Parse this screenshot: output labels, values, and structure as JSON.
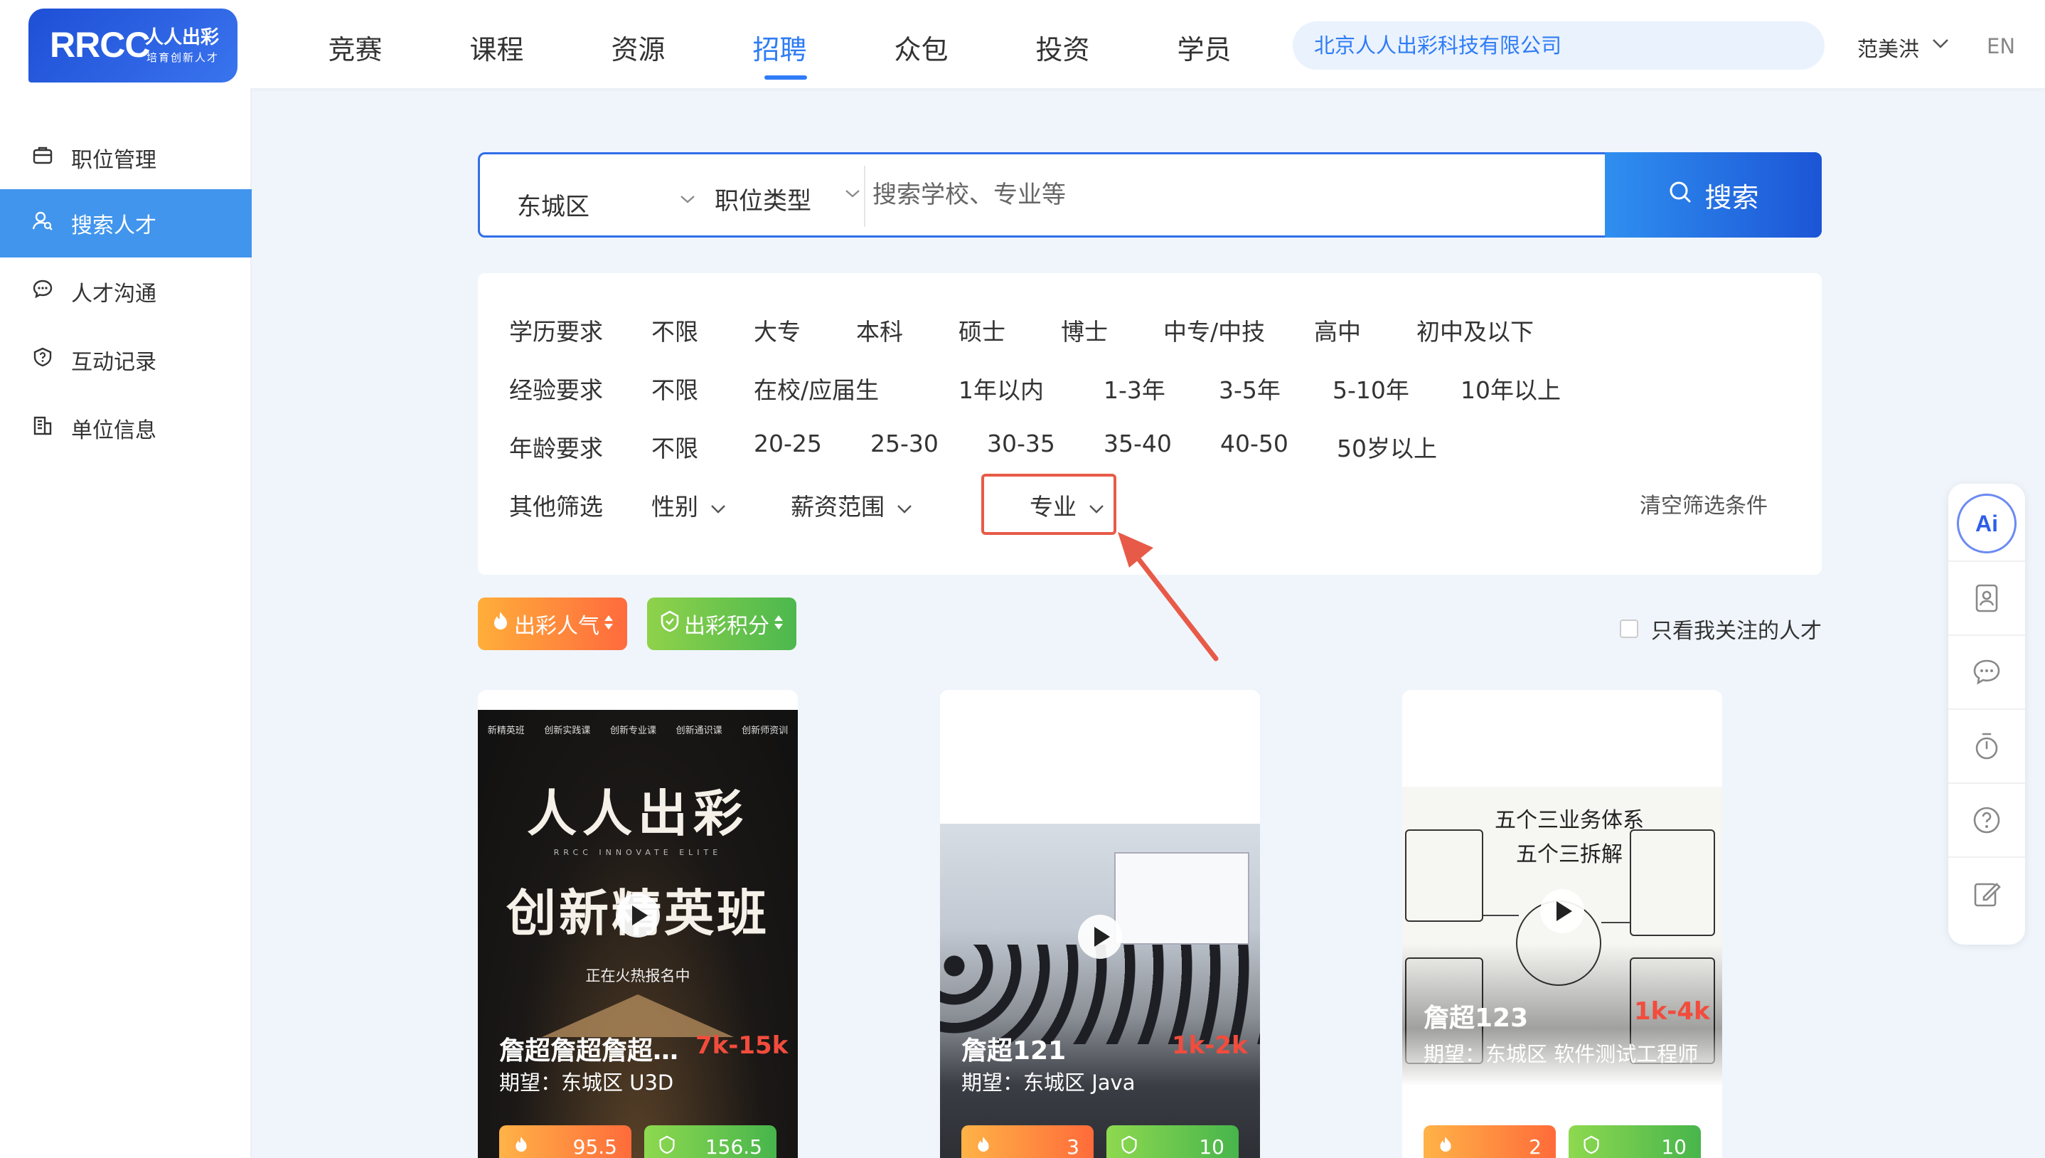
{
  "header": {
    "logo_main": "RRCC",
    "logo_cn": "人人出彩",
    "logo_sub": "培育创新人才",
    "nav": [
      "竞赛",
      "课程",
      "资源",
      "招聘",
      "众包",
      "投资",
      "学员"
    ],
    "active_nav": "招聘",
    "company": "北京人人出彩科技有限公司",
    "user": "范美洪",
    "lang": "EN"
  },
  "sidebar": {
    "items": [
      {
        "label": "职位管理",
        "icon": "briefcase-icon"
      },
      {
        "label": "搜索人才",
        "icon": "user-search-icon"
      },
      {
        "label": "人才沟通",
        "icon": "chat-icon"
      },
      {
        "label": "互动记录",
        "icon": "question-shield-icon"
      },
      {
        "label": "单位信息",
        "icon": "building-icon"
      }
    ],
    "active": "搜索人才"
  },
  "search": {
    "area": "东城区",
    "job_type": "职位类型",
    "placeholder": "搜索学校、专业等",
    "button": "搜索"
  },
  "filters": {
    "education": {
      "label": "学历要求",
      "options": [
        "不限",
        "大专",
        "本科",
        "硕士",
        "博士",
        "中专/中技",
        "高中",
        "初中及以下"
      ]
    },
    "experience": {
      "label": "经验要求",
      "options": [
        "不限",
        "在校/应届生",
        "1年以内",
        "1-3年",
        "3-5年",
        "5-10年",
        "10年以上"
      ]
    },
    "age": {
      "label": "年龄要求",
      "options": [
        "不限",
        "20-25",
        "25-30",
        "30-35",
        "35-40",
        "40-50",
        "50岁以上"
      ]
    },
    "other": {
      "label": "其他筛选",
      "gender": "性别",
      "salary": "薪资范围",
      "major": "专业"
    },
    "clear": "清空筛选条件"
  },
  "sort": {
    "popularity": "出彩人气",
    "points": "出彩积分",
    "follow_only": "只看我关注的人才"
  },
  "cards": [
    {
      "name": "詹超詹超詹超詹超",
      "salary": "7k-15k",
      "expect": "期望：东城区 U3D",
      "hot": "95.5",
      "points": "156.5",
      "poster": {
        "tabs": [
          "新精英班",
          "创新实践课",
          "创新专业课",
          "创新通识课",
          "创新师资训"
        ],
        "title1": "人人出彩",
        "sub": "RRCC INNOVATE ELITE",
        "title2": "创新精英班",
        "enroll": "正在火热报名中"
      }
    },
    {
      "name": "詹超121",
      "salary": "1k-2k",
      "expect": "期望：东城区 Java",
      "hot": "3",
      "points": "10"
    },
    {
      "name": "詹超123",
      "salary": "1k-4k",
      "expect": "期望：东城区 软件测试工程师",
      "hot": "2",
      "points": "10",
      "board": {
        "title": "五个三业务体系",
        "subtitle": "五个三拆解"
      }
    }
  ],
  "colors": {
    "primary": "#2f7cf6",
    "sidebar_active": "#4195ec",
    "highlight": "#e85a48",
    "salary": "#f24c3d"
  }
}
